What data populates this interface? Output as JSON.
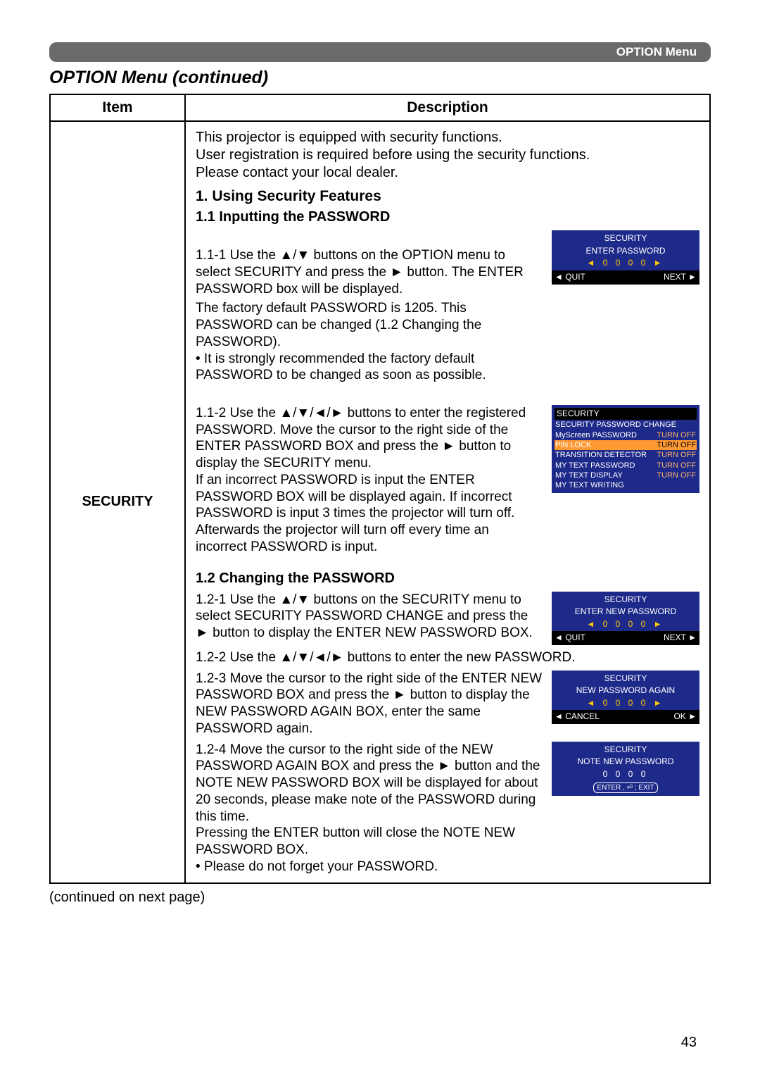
{
  "header_label": "OPTION Menu",
  "page_title": "OPTION Menu (continued)",
  "table": {
    "col_item": "Item",
    "col_desc": "Description",
    "item_name": "SECURITY"
  },
  "intro": "This projector is equipped with security functions.\nUser registration is required before using the security functions.\nPlease contact your local dealer.",
  "sec1_title": "1. Using Security Features",
  "sec11_title": "1.1 Inputting the PASSWORD",
  "step_111": "1.1-1 Use the ▲/▼ buttons on the OPTION menu to select SECURITY and press the ► button. The ENTER PASSWORD box will be displayed.",
  "step_111_note": "The factory default PASSWORD is 1205. This PASSWORD can be changed (1.2 Changing the PASSWORD).\n• It is strongly recommended the factory default PASSWORD to be changed as soon as possible.",
  "step_112": "1.1-2 Use the ▲/▼/◄/► buttons to enter the registered PASSWORD. Move the cursor to the right side of the ENTER PASSWORD BOX and press the ► button to display the SECURITY menu.\nIf an incorrect PASSWORD is input the ENTER PASSWORD BOX will be displayed again. If incorrect PASSWORD is input 3 times the projector will turn off. Afterwards the projector will turn off every time an incorrect PASSWORD is input.",
  "sec12_title": "1.2 Changing the PASSWORD",
  "step_121": "1.2-1 Use the ▲/▼ buttons on the SECURITY menu to select SECURITY PASSWORD CHANGE and press the ► button to display the ENTER NEW PASSWORD BOX.",
  "step_122": "1.2-2 Use the ▲/▼/◄/► buttons to enter the new PASSWORD.",
  "step_123": "1.2-3 Move the cursor to the right side of the ENTER NEW PASSWORD BOX and press the ► button to display the NEW PASSWORD AGAIN BOX, enter the same PASSWORD again.",
  "step_124": "1.2-4 Move the cursor to the right side of the NEW PASSWORD AGAIN BOX and press the ► button and the NOTE NEW PASSWORD BOX will be displayed for about 20 seconds, please make note of the PASSWORD during this time.\nPressing the ENTER button will close the NOTE NEW PASSWORD BOX.\n• Please do not forget your PASSWORD.",
  "continued": "(continued on next page)",
  "page_number": "43",
  "osd": {
    "security": "SECURITY",
    "enter_pw": "ENTER PASSWORD",
    "digits": "◄ 0 0 0 0 ►",
    "quit": "◄ QUIT",
    "next": "NEXT ►",
    "menu_items": [
      {
        "label": "SECURITY PASSWORD CHANGE",
        "val": ""
      },
      {
        "label": "MyScreen PASSWORD",
        "val": "TURN OFF"
      },
      {
        "label": "PIN LOCK",
        "val": "TURN OFF"
      },
      {
        "label": "TRANSITION DETECTOR",
        "val": "TURN OFF"
      },
      {
        "label": "MY TEXT PASSWORD",
        "val": "TURN OFF"
      },
      {
        "label": "MY TEXT DISPLAY",
        "val": "TURN OFF"
      },
      {
        "label": "MY TEXT WRITING",
        "val": ""
      }
    ],
    "enter_new_pw": "ENTER NEW PASSWORD",
    "new_pw_again": "NEW PASSWORD AGAIN",
    "cancel": "◄ CANCEL",
    "ok": "OK ►",
    "note_new_pw": "NOTE NEW PASSWORD",
    "plain_digits": "0 0 0 0",
    "enter_exit": "ENTER , ⏎ ; EXIT"
  }
}
